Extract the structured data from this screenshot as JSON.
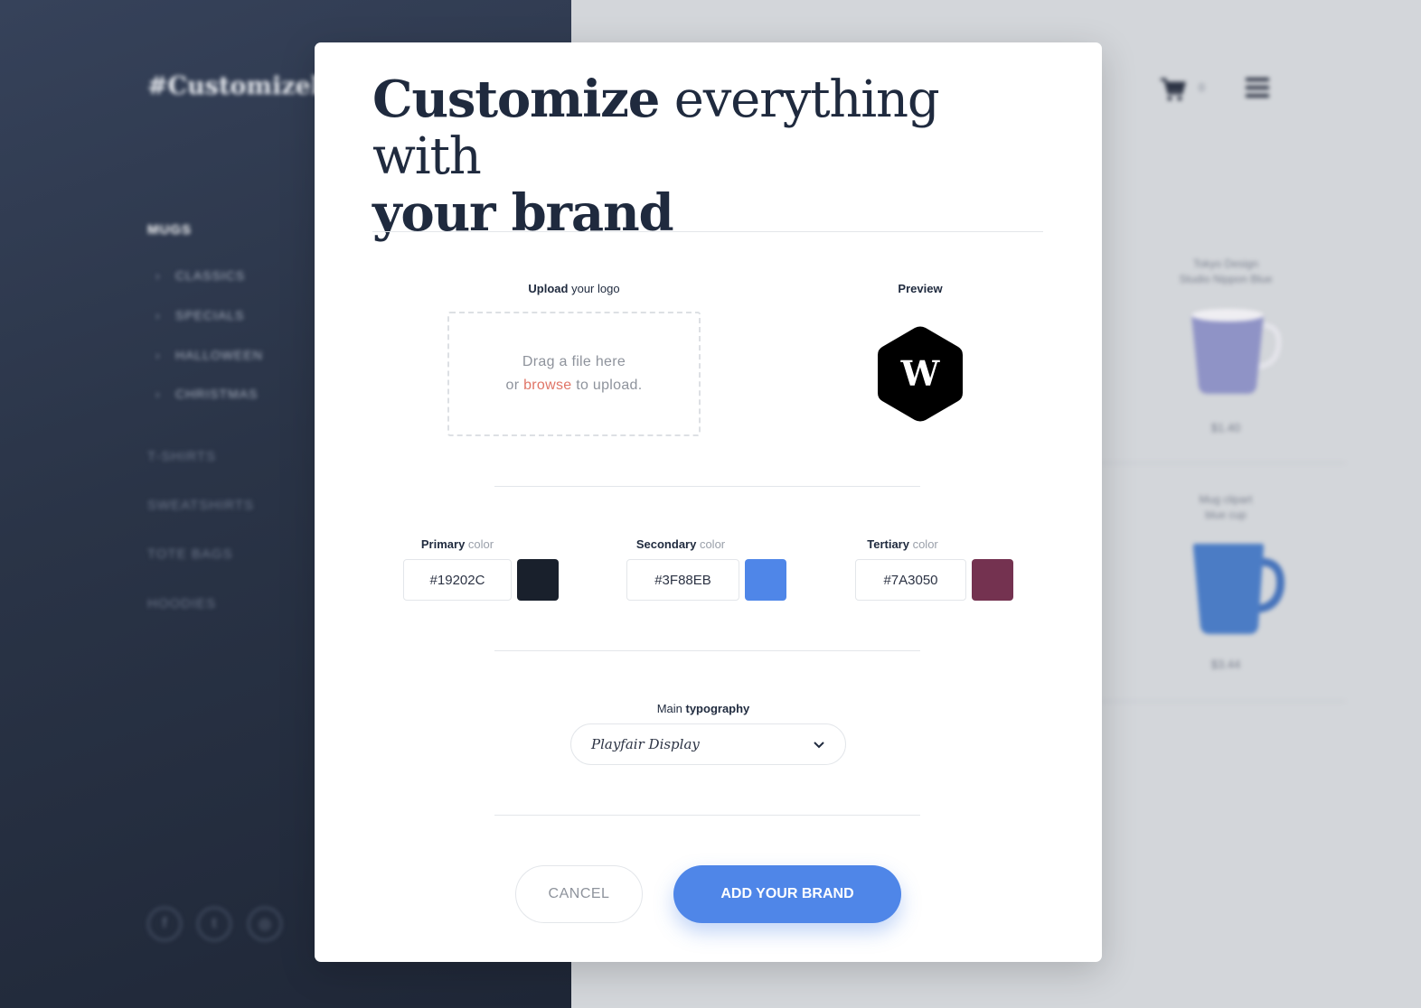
{
  "background": {
    "logo": "#Customizely",
    "category_title": "MUGS",
    "subcategories": [
      "CLASSICS",
      "SPECIALS",
      "HALLOWEEN",
      "CHRISTMAS"
    ],
    "categories": [
      "T-SHIRTS",
      "SWEATSHIRTS",
      "TOTE BAGS",
      "HOODIES"
    ],
    "social_icons": [
      "facebook-icon",
      "twitter-icon",
      "instagram-icon"
    ],
    "cart_count": "0",
    "products": [
      {
        "name_line1": "Tokyo Design",
        "name_line2": "Studio Nippon Blue",
        "price": "$1.40"
      },
      {
        "name_line1": "Mug clipart",
        "name_line2": "blue cup",
        "price": "$3.44"
      }
    ]
  },
  "modal": {
    "title_bold": "Customize",
    "title_rest": " everything with",
    "title_line2": "your brand",
    "upload": {
      "label_bold": "Upload",
      "label_rest": " your logo",
      "drop_line1": "Drag a file here",
      "drop_or": "or ",
      "drop_browse": "browse",
      "drop_rest": " to upload."
    },
    "preview": {
      "label": "Preview",
      "logo_letter": "W"
    },
    "colors": [
      {
        "label_bold": "Primary",
        "label_rest": " color",
        "value": "#19202C",
        "swatch": "#19202C"
      },
      {
        "label_bold": "Secondary",
        "label_rest": " color",
        "value": "#3F88EB",
        "swatch": "#4F86E8"
      },
      {
        "label_bold": "Tertiary",
        "label_rest": " color",
        "value": "#7A3050",
        "swatch": "#743250"
      }
    ],
    "typography": {
      "label_light": "Main ",
      "label_bold": "typography",
      "selected": "Playfair Display"
    },
    "buttons": {
      "cancel": "CANCEL",
      "add": "ADD YOUR BRAND"
    }
  },
  "theme": {
    "accent": "#4F86E8",
    "link": "#E07567",
    "text_dark": "#1F2A3E"
  }
}
